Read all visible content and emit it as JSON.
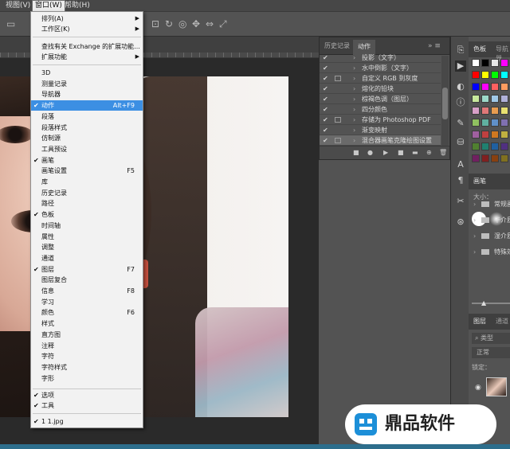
{
  "menubar": {
    "items": [
      "视图(V)",
      "窗口(W)",
      "帮助(H)"
    ]
  },
  "window_menu": {
    "top_items": [
      {
        "label": "排列(A)",
        "submenu": true
      },
      {
        "label": "工作区(K)",
        "submenu": true
      }
    ],
    "ext_items": [
      {
        "label": "查找有关 Exchange 的扩展功能...",
        "submenu": false
      },
      {
        "label": "扩展功能",
        "submenu": true
      }
    ],
    "panel_items": [
      {
        "label": "3D",
        "checked": false,
        "shortcut": ""
      },
      {
        "label": "测量记录",
        "checked": false,
        "shortcut": ""
      },
      {
        "label": "导航器",
        "checked": false,
        "shortcut": ""
      },
      {
        "label": "动作",
        "checked": true,
        "shortcut": "Alt+F9",
        "highlighted": true
      },
      {
        "label": "段落",
        "checked": false,
        "shortcut": ""
      },
      {
        "label": "段落样式",
        "checked": false,
        "shortcut": ""
      },
      {
        "label": "仿制源",
        "checked": false,
        "shortcut": ""
      },
      {
        "label": "工具预设",
        "checked": false,
        "shortcut": ""
      },
      {
        "label": "画笔",
        "checked": true,
        "shortcut": ""
      },
      {
        "label": "画笔设置",
        "checked": false,
        "shortcut": "F5"
      },
      {
        "label": "库",
        "checked": false,
        "shortcut": ""
      },
      {
        "label": "历史记录",
        "checked": false,
        "shortcut": ""
      },
      {
        "label": "路径",
        "checked": false,
        "shortcut": ""
      },
      {
        "label": "色板",
        "checked": true,
        "shortcut": ""
      },
      {
        "label": "时间轴",
        "checked": false,
        "shortcut": ""
      },
      {
        "label": "属性",
        "checked": false,
        "shortcut": ""
      },
      {
        "label": "调整",
        "checked": false,
        "shortcut": ""
      },
      {
        "label": "通道",
        "checked": false,
        "shortcut": ""
      },
      {
        "label": "图层",
        "checked": true,
        "shortcut": "F7"
      },
      {
        "label": "图层复合",
        "checked": false,
        "shortcut": ""
      },
      {
        "label": "信息",
        "checked": false,
        "shortcut": "F8"
      },
      {
        "label": "学习",
        "checked": false,
        "shortcut": ""
      },
      {
        "label": "颜色",
        "checked": false,
        "shortcut": "F6"
      },
      {
        "label": "样式",
        "checked": false,
        "shortcut": ""
      },
      {
        "label": "直方图",
        "checked": false,
        "shortcut": ""
      },
      {
        "label": "注释",
        "checked": false,
        "shortcut": ""
      },
      {
        "label": "字符",
        "checked": false,
        "shortcut": ""
      },
      {
        "label": "字符样式",
        "checked": false,
        "shortcut": ""
      },
      {
        "label": "字形",
        "checked": false,
        "shortcut": ""
      }
    ],
    "option_items": [
      {
        "label": "选项",
        "checked": true
      },
      {
        "label": "工具",
        "checked": true
      }
    ],
    "doc_items": [
      {
        "label": "1 1.jpg",
        "checked": true
      }
    ]
  },
  "actions_panel": {
    "tabs": [
      "历史记录",
      "动作"
    ],
    "menu_glyphs": "» ≡",
    "rows": [
      {
        "name": "投影（文字）",
        "selected": false
      },
      {
        "name": "水中倒影（文字）",
        "selected": false
      },
      {
        "name": "自定义 RGB 到灰度",
        "selected": false
      },
      {
        "name": "熔化的铅块",
        "selected": false
      },
      {
        "name": "棕褐色调（图层）",
        "selected": false
      },
      {
        "name": "四分颜色",
        "selected": false
      },
      {
        "name": "存储为 Photoshop PDF",
        "selected": false
      },
      {
        "name": "渐变映射",
        "selected": false
      },
      {
        "name": "混合器画笔克隆绘图设置",
        "selected": true
      }
    ],
    "footer_icons": [
      "■",
      "●",
      "▶",
      "■",
      "▬",
      "⊕",
      "🗑"
    ]
  },
  "right_panel": {
    "swatch_tabs": [
      "色板",
      "导航器"
    ],
    "brush_tab": "画笔",
    "brush_size_label": "大小：",
    "brush_groups": [
      "常规画",
      "干介质",
      "湿介质",
      "特殊效"
    ],
    "layer_tabs": [
      "图层",
      "通道"
    ],
    "layer_kind": "类型",
    "blend_mode": "正常",
    "lock_label": "锁定："
  },
  "watermark": {
    "text": "鼎品软件"
  },
  "colors": {
    "menu_highlight": "#3c8fe3",
    "panel_bg": "#535353",
    "menu_bg": "#f2f2f2"
  }
}
